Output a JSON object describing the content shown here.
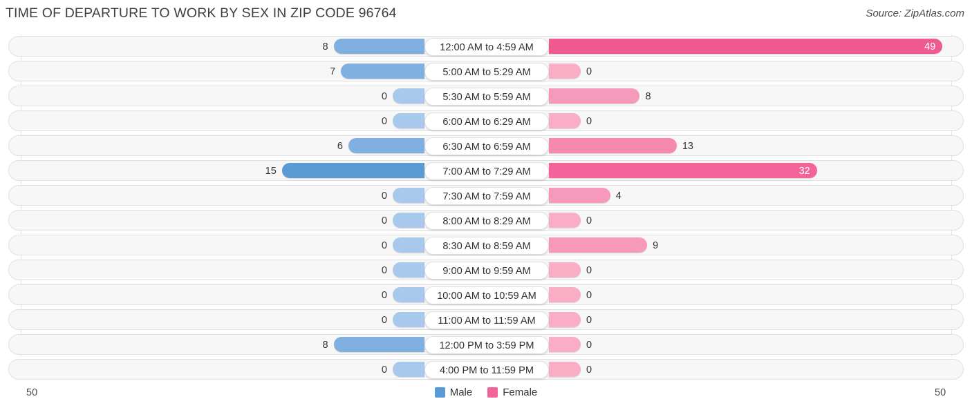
{
  "header": {
    "title": "TIME OF DEPARTURE TO WORK BY SEX IN ZIP CODE 96764",
    "source": "Source: ZipAtlas.com"
  },
  "legend": {
    "male_label": "Male",
    "female_label": "Female",
    "male_color": "#5b9bd5",
    "female_color": "#f4649a"
  },
  "axis": {
    "left_max": "50",
    "right_max": "50"
  },
  "chart_data": {
    "type": "bar",
    "orientation": "horizontal-diverging",
    "title": "TIME OF DEPARTURE TO WORK BY SEX IN ZIP CODE 96764",
    "xlabel": "",
    "ylabel": "",
    "xlim": [
      50,
      50
    ],
    "grid": true,
    "legend_position": "bottom-center",
    "categories": [
      "12:00 AM to 4:59 AM",
      "5:00 AM to 5:29 AM",
      "5:30 AM to 5:59 AM",
      "6:00 AM to 6:29 AM",
      "6:30 AM to 6:59 AM",
      "7:00 AM to 7:29 AM",
      "7:30 AM to 7:59 AM",
      "8:00 AM to 8:29 AM",
      "8:30 AM to 8:59 AM",
      "9:00 AM to 9:59 AM",
      "10:00 AM to 10:59 AM",
      "11:00 AM to 11:59 AM",
      "12:00 PM to 3:59 PM",
      "4:00 PM to 11:59 PM"
    ],
    "series": [
      {
        "name": "Male",
        "values": [
          8,
          7,
          0,
          0,
          6,
          15,
          0,
          0,
          0,
          0,
          0,
          0,
          8,
          0
        ]
      },
      {
        "name": "Female",
        "values": [
          49,
          0,
          8,
          0,
          13,
          32,
          4,
          0,
          9,
          0,
          0,
          0,
          0,
          0
        ]
      }
    ]
  },
  "rows": [
    {
      "label": "12:00 AM to 4:59 AM",
      "male": "8",
      "female": "49"
    },
    {
      "label": "5:00 AM to 5:29 AM",
      "male": "7",
      "female": "0"
    },
    {
      "label": "5:30 AM to 5:59 AM",
      "male": "0",
      "female": "8"
    },
    {
      "label": "6:00 AM to 6:29 AM",
      "male": "0",
      "female": "0"
    },
    {
      "label": "6:30 AM to 6:59 AM",
      "male": "6",
      "female": "13"
    },
    {
      "label": "7:00 AM to 7:29 AM",
      "male": "15",
      "female": "32"
    },
    {
      "label": "7:30 AM to 7:59 AM",
      "male": "0",
      "female": "4"
    },
    {
      "label": "8:00 AM to 8:29 AM",
      "male": "0",
      "female": "0"
    },
    {
      "label": "8:30 AM to 8:59 AM",
      "male": "0",
      "female": "9"
    },
    {
      "label": "9:00 AM to 9:59 AM",
      "male": "0",
      "female": "0"
    },
    {
      "label": "10:00 AM to 10:59 AM",
      "male": "0",
      "female": "0"
    },
    {
      "label": "11:00 AM to 11:59 AM",
      "male": "0",
      "female": "0"
    },
    {
      "label": "12:00 PM to 3:59 PM",
      "male": "8",
      "female": "0"
    },
    {
      "label": "4:00 PM to 11:59 PM",
      "male": "0",
      "female": "0"
    }
  ]
}
